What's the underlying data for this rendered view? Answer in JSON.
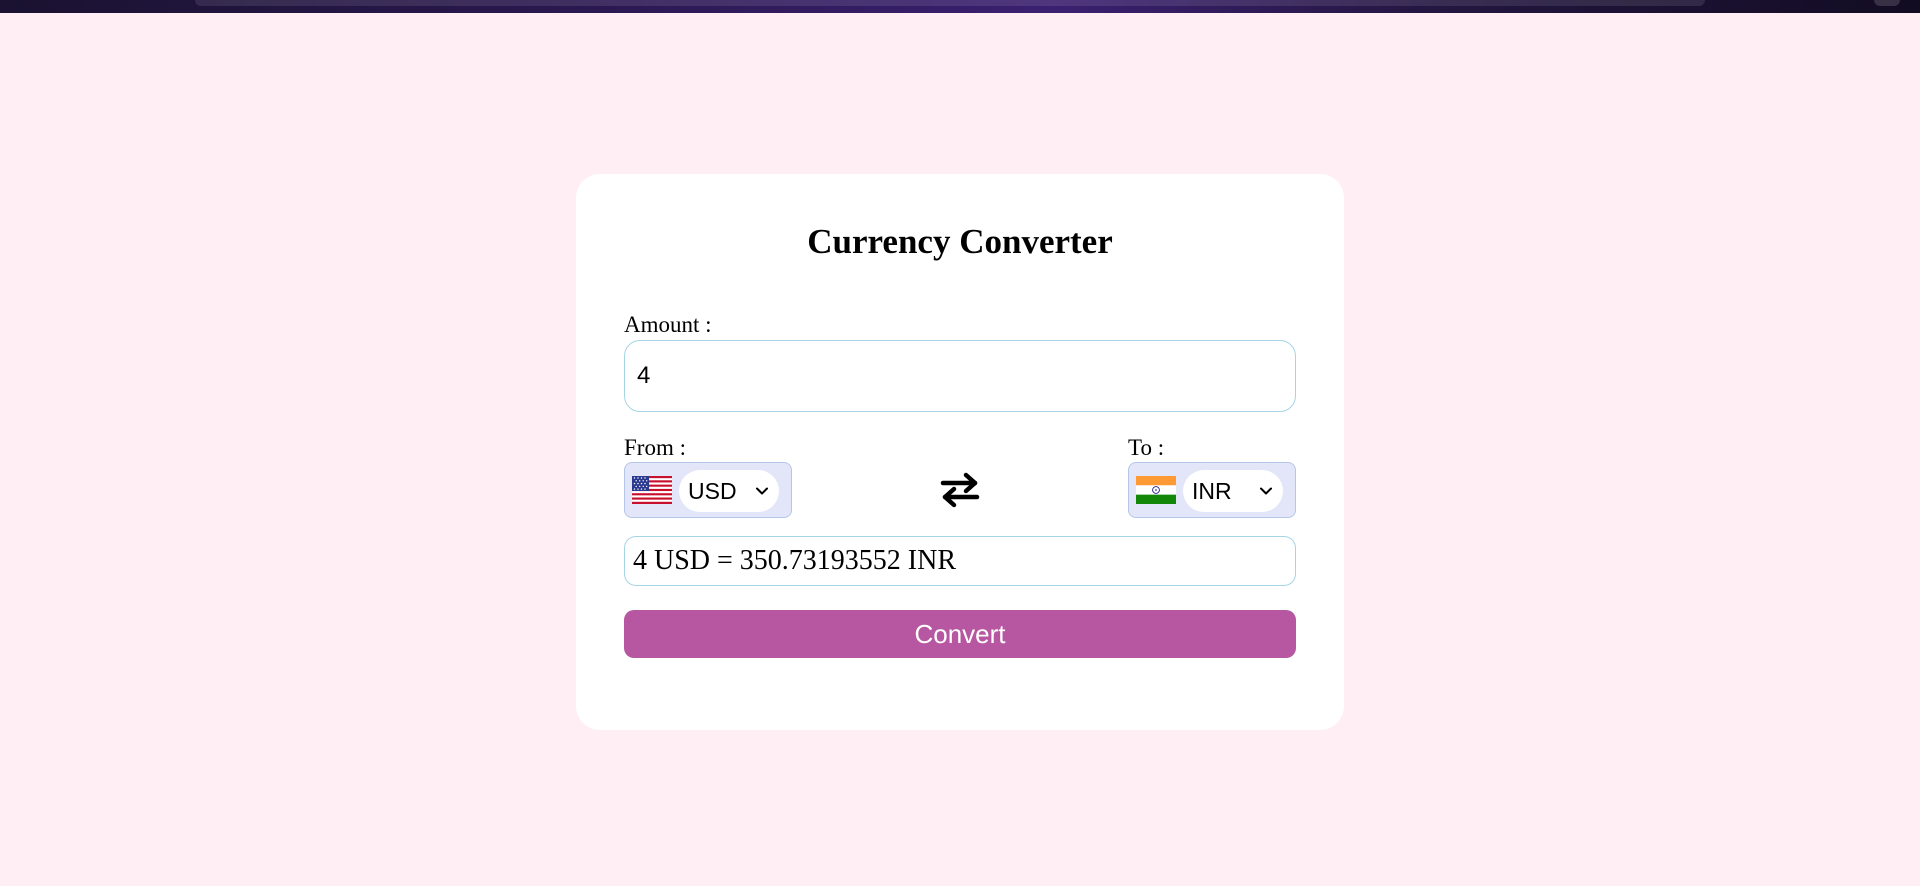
{
  "app": {
    "title": "Currency Converter",
    "background_color": "#ffeef3",
    "accent_color": "#b757a1"
  },
  "amount": {
    "label": "Amount :",
    "value": "4"
  },
  "from": {
    "label": "From :",
    "currency": "USD",
    "flag_icon": "us-flag-icon"
  },
  "to": {
    "label": "To :",
    "currency": "INR",
    "flag_icon": "india-flag-icon"
  },
  "swap": {
    "icon": "swap-arrows-icon"
  },
  "result": {
    "text": "4 USD = 350.73193552 INR"
  },
  "convert_button": {
    "label": "Convert"
  }
}
